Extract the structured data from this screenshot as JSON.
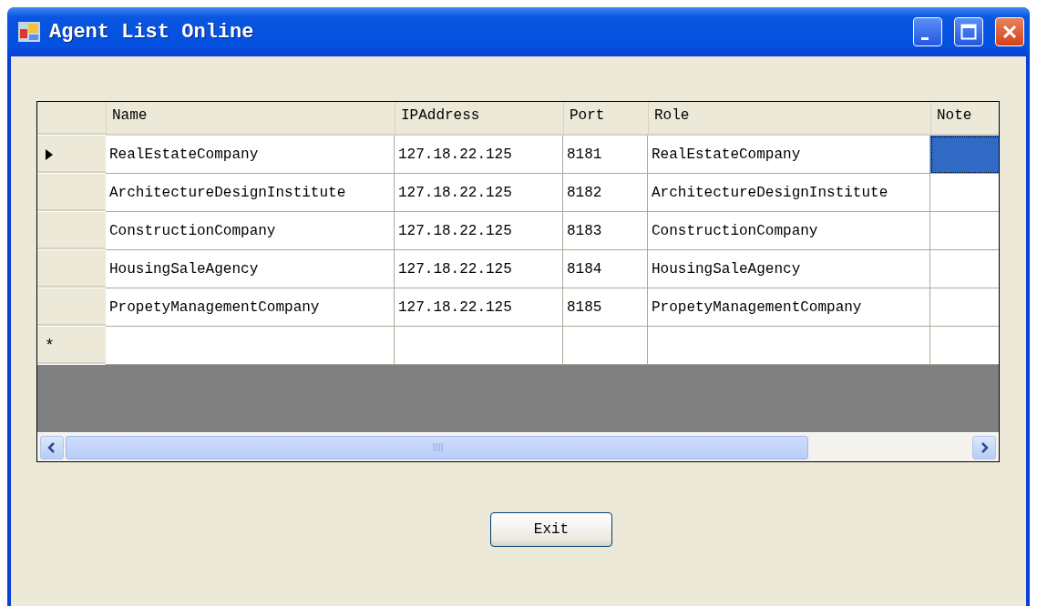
{
  "window": {
    "title": "Agent List Online"
  },
  "grid": {
    "columns": [
      "Name",
      "IPAddress",
      "Port",
      "Role",
      "Note"
    ],
    "rows": [
      {
        "current": true,
        "cells": [
          {
            "text": "RealEstateCompany",
            "selected": false
          },
          {
            "text": "127.18.22.125",
            "selected": false
          },
          {
            "text": "8181",
            "selected": false
          },
          {
            "text": "RealEstateCompany",
            "selected": false
          },
          {
            "selected": true
          }
        ]
      },
      {
        "current": false,
        "cells": [
          {
            "text": "ArchitectureDesignInstitute",
            "selected": false
          },
          {
            "text": "127.18.22.125",
            "selected": false
          },
          {
            "text": "8182",
            "selected": false
          },
          {
            "text": "ArchitectureDesignInstitute",
            "selected": false
          },
          {
            "selected": false
          }
        ]
      },
      {
        "current": false,
        "cells": [
          {
            "text": "ConstructionCompany",
            "selected": false
          },
          {
            "text": "127.18.22.125",
            "selected": false
          },
          {
            "text": "8183",
            "selected": false
          },
          {
            "text": "ConstructionCompany",
            "selected": false
          },
          {
            "selected": false
          }
        ]
      },
      {
        "current": false,
        "cells": [
          {
            "text": "HousingSaleAgency",
            "selected": false
          },
          {
            "text": "127.18.22.125",
            "selected": false
          },
          {
            "text": "8184",
            "selected": false
          },
          {
            "text": "HousingSaleAgency",
            "selected": false
          },
          {
            "selected": false
          }
        ]
      },
      {
        "current": false,
        "cells": [
          {
            "text": "PropetyManagementCompany",
            "selected": false
          },
          {
            "text": "127.18.22.125",
            "selected": false
          },
          {
            "text": "8185",
            "selected": false
          },
          {
            "text": "PropetyManagementCompany",
            "selected": false
          },
          {
            "selected": false
          }
        ]
      }
    ],
    "new_row_marker": "*"
  },
  "buttons": [
    {
      "label": "Exit"
    }
  ]
}
